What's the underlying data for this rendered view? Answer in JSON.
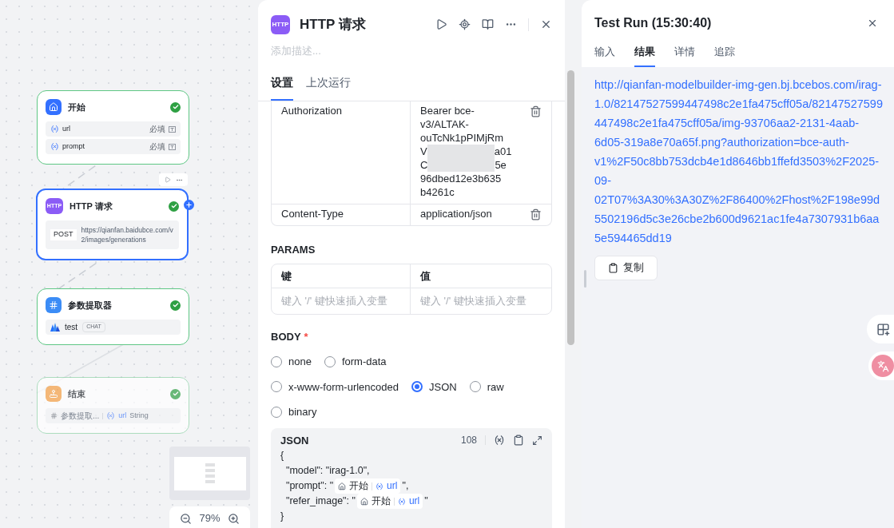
{
  "canvas": {
    "nodes": [
      {
        "kind": "start",
        "title": "开始",
        "selected": false,
        "dimmed": false,
        "variables": [
          {
            "name": "url",
            "required": "必填"
          },
          {
            "name": "prompt",
            "required": "必填"
          }
        ]
      },
      {
        "kind": "http",
        "title": "HTTP 请求",
        "icon_text": "HTTP",
        "selected": true,
        "dimmed": false,
        "method": "POST",
        "url": "https://qianfan.baidubce.com/v2/images/generations"
      },
      {
        "kind": "extractor",
        "title": "参数提取器",
        "selected": false,
        "dimmed": false,
        "model": "test",
        "badge": "CHAT"
      },
      {
        "kind": "end",
        "title": "结束",
        "selected": false,
        "dimmed": true,
        "source": "参数提取...",
        "variable": "url",
        "type": "String"
      }
    ],
    "zoom": "79%"
  },
  "panel": {
    "icon_text": "HTTP",
    "title": "HTTP 请求",
    "description_placeholder": "添加描述...",
    "tabs": [
      {
        "label": "设置",
        "selected": true
      },
      {
        "label": "上次运行",
        "selected": false
      }
    ],
    "headers": [
      {
        "key": "Authorization",
        "value_lines": [
          {
            "kind": "text",
            "text": "Bearer bce-"
          },
          {
            "kind": "text",
            "text": "v3/ALTAK-"
          },
          {
            "kind": "text",
            "text": "ouTcNk1pPIMjRm"
          },
          {
            "kind": "redacted",
            "left": "V",
            "right": "a01"
          },
          {
            "kind": "redacted",
            "left": "C",
            "right": "5e"
          },
          {
            "kind": "text",
            "text": "96dbed12e3b635"
          },
          {
            "kind": "text",
            "text": "b4261c"
          }
        ]
      },
      {
        "key": "Content-Type",
        "value_lines": [
          {
            "kind": "text",
            "text": "application/json"
          }
        ]
      }
    ],
    "params": {
      "title": "PARAMS",
      "columns": [
        "键",
        "值"
      ],
      "placeholders": [
        "键入 '/' 键快速插入变量",
        "键入 '/' 键快速插入变量"
      ]
    },
    "body": {
      "title": "BODY",
      "required_mark": "*",
      "options": [
        {
          "label": "none",
          "selected": false
        },
        {
          "label": "form-data",
          "selected": false
        },
        {
          "label": "x-www-form-urlencoded",
          "selected": false
        },
        {
          "label": "JSON",
          "selected": true
        },
        {
          "label": "raw",
          "selected": false
        },
        {
          "label": "binary",
          "selected": false
        }
      ],
      "editor": {
        "title": "JSON",
        "count": "108",
        "lines": [
          {
            "kind": "text",
            "text": "{"
          },
          {
            "kind": "text",
            "text": "  \"model\": \"irag-1.0\","
          },
          {
            "kind": "var",
            "prefix": "  \"prompt\": \"",
            "node": "开始",
            "variable": "url",
            "suffix": "\","
          },
          {
            "kind": "var",
            "prefix": "  \"refer_image\": \"",
            "node": "开始",
            "variable": "url",
            "suffix": "\""
          },
          {
            "kind": "text",
            "text": "}"
          }
        ]
      }
    }
  },
  "test_run": {
    "title": "Test Run (15:30:40)",
    "tabs": [
      {
        "label": "输入",
        "selected": false
      },
      {
        "label": "结果",
        "selected": true
      },
      {
        "label": "详情",
        "selected": false
      },
      {
        "label": "追踪",
        "selected": false
      }
    ],
    "result": "http://qianfan-modelbuilder-img-gen.bj.bcebos.com/irag-1.0/82147527599447498c2e1fa475cff05a/82147527599447498c2e1fa475cff05a/img-93706aa2-2131-4aab-6d05-319a8e70a65f.png?authorization=bce-auth-v1%2F50c8bb753dcb4e1d8646bb1ffefd3503%2F2025-09-02T07%3A30%3A30Z%2F86400%2Fhost%2F198e99d5502196d5c3e26cbe2b600d9621ac1fe4a7307931b6aa5e594465dd19",
    "copy_label": "复制"
  }
}
